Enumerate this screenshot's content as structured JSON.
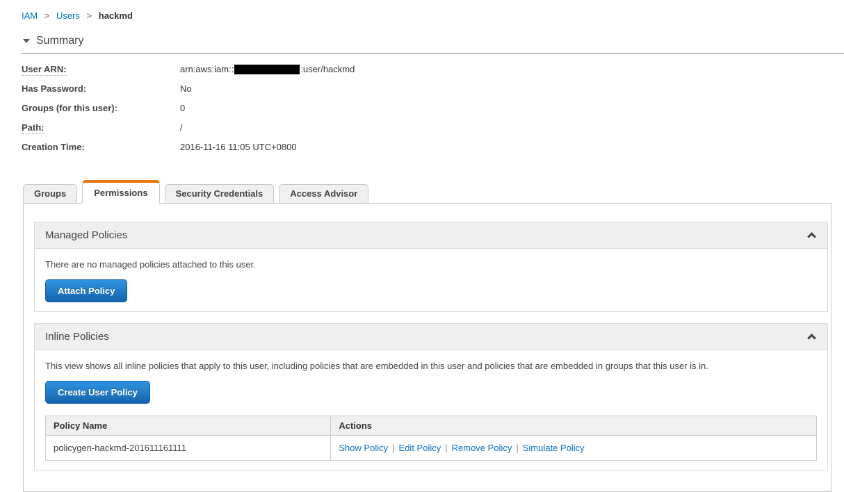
{
  "colors": {
    "link_blue": "#0073bb",
    "action_link_blue": "#0b72c6",
    "active_tab_orange": "#e87511",
    "primary_button_blue_top": "#2f94e0",
    "primary_button_blue_bottom": "#1563ae",
    "redaction_black": "#000000"
  },
  "breadcrumb": {
    "separator": ">",
    "items": [
      {
        "label": "IAM"
      },
      {
        "label": "Users"
      },
      {
        "label": "hackmd"
      }
    ]
  },
  "summary": {
    "title": "Summary",
    "fields": [
      {
        "label": "User ARN:",
        "value_prefix": "arn:aws:iam::",
        "redacted": true,
        "value_suffix": ":user/hackmd"
      },
      {
        "label": "Has Password:",
        "value": "No"
      },
      {
        "label": "Groups (for this user):",
        "value": "0"
      },
      {
        "label": "Path:",
        "value": "/"
      },
      {
        "label": "Creation Time:",
        "value": "2016-11-16 11:05 UTC+0800"
      }
    ]
  },
  "tabs": [
    {
      "label": "Groups",
      "active": false
    },
    {
      "label": "Permissions",
      "active": true
    },
    {
      "label": "Security Credentials",
      "active": false
    },
    {
      "label": "Access Advisor",
      "active": false
    }
  ],
  "managed_policies": {
    "title": "Managed Policies",
    "empty_message": "There are no managed policies attached to this user.",
    "attach_button_label": "Attach Policy"
  },
  "inline_policies": {
    "title": "Inline Policies",
    "description": "This view shows all inline policies that apply to this user, including policies that are embedded in this user and policies that are embedded in groups that this user is in.",
    "create_button_label": "Create User Policy",
    "table": {
      "headers": [
        "Policy Name",
        "Actions"
      ],
      "action_separator": "|",
      "rows": [
        {
          "policy_name": "policygen-hackmd-201611161111",
          "actions": [
            "Show Policy",
            "Edit Policy",
            "Remove Policy",
            "Simulate Policy"
          ]
        }
      ]
    }
  }
}
